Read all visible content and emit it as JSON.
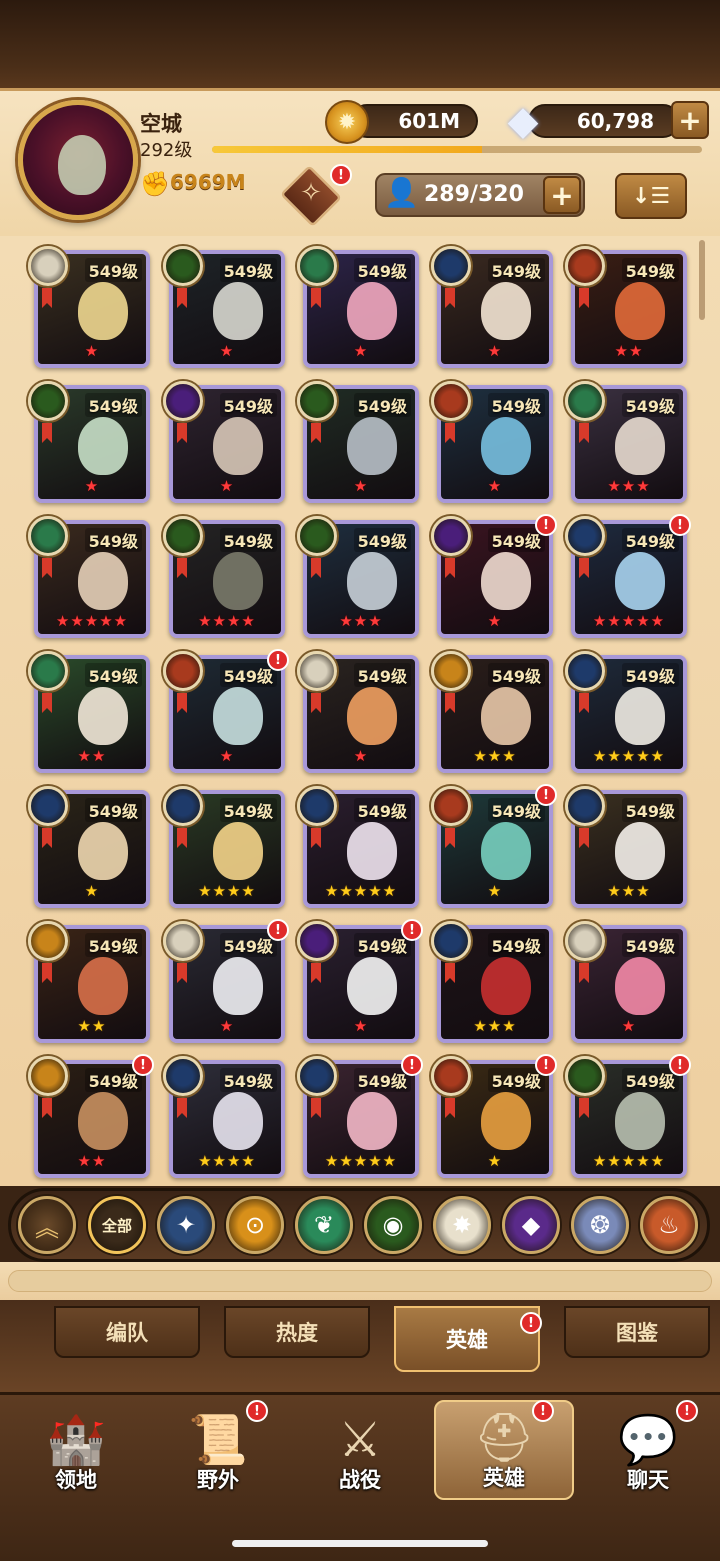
{
  "player": {
    "name": "空城",
    "level": "292级",
    "xp_fraction": 0.55,
    "power": "6969M"
  },
  "currency": {
    "gold": "601M",
    "diamonds": "60,798",
    "plus": "+"
  },
  "roster": {
    "count": "289/320",
    "plus": "+",
    "sort_label": "↓☰"
  },
  "badge_mark": "!",
  "heroes": [
    {
      "level": "549级",
      "stars": "★",
      "star_color": "red",
      "faction": "celestial",
      "badge": false,
      "art": "#3a3020",
      "face": "#f0d890"
    },
    {
      "level": "549级",
      "stars": "★",
      "star_color": "red",
      "faction": "wilder",
      "badge": false,
      "art": "#1e2428",
      "face": "#d8d8d0"
    },
    {
      "level": "549级",
      "stars": "★",
      "star_color": "red",
      "faction": "mauler",
      "badge": false,
      "art": "#2c2448",
      "face": "#f2a8c0"
    },
    {
      "level": "549级",
      "stars": "★",
      "star_color": "red",
      "faction": "lightbearer",
      "badge": false,
      "art": "#3a2a20",
      "face": "#f4e6d4"
    },
    {
      "level": "549级",
      "stars": "★★",
      "star_color": "red",
      "faction": "hypogean",
      "badge": false,
      "art": "#3a1e14",
      "face": "#e26a3a"
    },
    {
      "level": "549级",
      "stars": "★",
      "star_color": "red",
      "faction": "wilder",
      "badge": false,
      "art": "#2a3a2a",
      "face": "#c8e0c8"
    },
    {
      "level": "549级",
      "stars": "★",
      "star_color": "red",
      "faction": "graveborn",
      "badge": false,
      "art": "#2e2430",
      "face": "#d8c8b8"
    },
    {
      "level": "549级",
      "stars": "★",
      "star_color": "red",
      "faction": "wilder",
      "badge": false,
      "art": "#202c24",
      "face": "#b8c0c8"
    },
    {
      "level": "549级",
      "stars": "★",
      "star_color": "red",
      "faction": "hypogean",
      "badge": false,
      "art": "#1e3040",
      "face": "#78c0e0"
    },
    {
      "level": "549级",
      "stars": "★★★",
      "star_color": "red",
      "faction": "mauler",
      "badge": false,
      "art": "#3a3040",
      "face": "#e8dcd0"
    },
    {
      "level": "549级",
      "stars": "★★★★★",
      "star_color": "red",
      "faction": "mauler",
      "badge": false,
      "art": "#3a2a1e",
      "face": "#e6d0b8"
    },
    {
      "level": "549级",
      "stars": "★★★★",
      "star_color": "red",
      "faction": "wilder",
      "badge": false,
      "art": "#242424",
      "face": "#7a7a6a"
    },
    {
      "level": "549级",
      "stars": "★★★",
      "star_color": "red",
      "faction": "wilder",
      "badge": false,
      "art": "#1e2e3e",
      "face": "#c8d0d8"
    },
    {
      "level": "549级",
      "stars": "★",
      "star_color": "red",
      "faction": "graveborn",
      "badge": true,
      "art": "#3a1420",
      "face": "#f0dcd0"
    },
    {
      "level": "549级",
      "stars": "★★★★★",
      "star_color": "red",
      "faction": "lightbearer",
      "badge": true,
      "art": "#1e2a3e",
      "face": "#a8d4f0"
    },
    {
      "level": "549级",
      "stars": "★★",
      "star_color": "red",
      "faction": "mauler",
      "badge": false,
      "art": "#2a4a2a",
      "face": "#f2e8d8"
    },
    {
      "level": "549级",
      "stars": "★",
      "star_color": "red",
      "faction": "hypogean",
      "badge": true,
      "art": "#1e2a34",
      "face": "#c8e0e0"
    },
    {
      "level": "549级",
      "stars": "★",
      "star_color": "red",
      "faction": "celestial",
      "badge": false,
      "art": "#2a2420",
      "face": "#f0a060"
    },
    {
      "level": "549级",
      "stars": "★★★",
      "star_color": "gold",
      "faction": "dimensional",
      "badge": false,
      "art": "#2a1e1a",
      "face": "#e8c8a8"
    },
    {
      "level": "549级",
      "stars": "★★★★★",
      "star_color": "gold",
      "faction": "lightbearer",
      "badge": false,
      "art": "#1e2a3a",
      "face": "#f0ece4"
    },
    {
      "level": "549级",
      "stars": "★",
      "star_color": "gold",
      "faction": "lightbearer",
      "badge": false,
      "art": "#2a2418",
      "face": "#f0d8b0"
    },
    {
      "level": "549级",
      "stars": "★★★★",
      "star_color": "gold",
      "faction": "lightbearer",
      "badge": false,
      "art": "#2a3a24",
      "face": "#f4d48a"
    },
    {
      "level": "549级",
      "stars": "★★★★★",
      "star_color": "gold",
      "faction": "lightbearer",
      "badge": false,
      "art": "#2a1e2e",
      "face": "#f0e4f0"
    },
    {
      "level": "549级",
      "stars": "★",
      "star_color": "gold",
      "faction": "hypogean",
      "badge": true,
      "art": "#1e3a3a",
      "face": "#78d0c0"
    },
    {
      "level": "549级",
      "stars": "★★★",
      "star_color": "gold",
      "faction": "lightbearer",
      "badge": false,
      "art": "#3a3020",
      "face": "#f4f0ea"
    },
    {
      "level": "549级",
      "stars": "★★",
      "star_color": "gold",
      "faction": "dimensional",
      "badge": false,
      "art": "#3a2416",
      "face": "#d8704a"
    },
    {
      "level": "549级",
      "stars": "★",
      "star_color": "red",
      "faction": "celestial",
      "badge": true,
      "art": "#2a2a34",
      "face": "#f0f0f4"
    },
    {
      "level": "549级",
      "stars": "★",
      "star_color": "red",
      "faction": "graveborn",
      "badge": true,
      "art": "#2a2030",
      "face": "#f4f4f4"
    },
    {
      "level": "549级",
      "stars": "★★★",
      "star_color": "gold",
      "faction": "lightbearer",
      "badge": false,
      "art": "#1e1418",
      "face": "#c83030"
    },
    {
      "level": "549级",
      "stars": "★",
      "star_color": "red",
      "faction": "celestial",
      "badge": false,
      "art": "#3a2434",
      "face": "#f48aa8"
    },
    {
      "level": "549级",
      "stars": "★★",
      "star_color": "red",
      "faction": "dimensional",
      "badge": true,
      "art": "#2a1e14",
      "face": "#c89060"
    },
    {
      "level": "549级",
      "stars": "★★★★",
      "star_color": "gold",
      "faction": "lightbearer",
      "badge": false,
      "art": "#2e2e3a",
      "face": "#e8e4f0"
    },
    {
      "level": "549级",
      "stars": "★★★★★",
      "star_color": "gold",
      "faction": "lightbearer",
      "badge": true,
      "art": "#3a2430",
      "face": "#f4b8c8"
    },
    {
      "level": "549级",
      "stars": "★",
      "star_color": "gold",
      "faction": "hypogean",
      "badge": true,
      "art": "#3a2a14",
      "face": "#e8a040"
    },
    {
      "level": "549级",
      "stars": "★★★★★",
      "star_color": "gold",
      "faction": "wilder",
      "badge": true,
      "art": "#2a2e28",
      "face": "#b8c0b0"
    }
  ],
  "factions": [
    {
      "id": "all",
      "label": "全部",
      "bg": "#3a2a1a",
      "glyph": ""
    },
    {
      "id": "lightbearer",
      "label": "",
      "bg": "#2a4a7a",
      "glyph": "✦"
    },
    {
      "id": "dimensional",
      "label": "",
      "bg": "#d8901a",
      "glyph": "⊙"
    },
    {
      "id": "mauler",
      "label": "",
      "bg": "#2a8a5a",
      "glyph": "❦"
    },
    {
      "id": "wilder",
      "label": "",
      "bg": "#2a5a1e",
      "glyph": "◉"
    },
    {
      "id": "celestial",
      "label": "",
      "bg": "#e8e0cc",
      "glyph": "✸"
    },
    {
      "id": "graveborn",
      "label": "",
      "bg": "#5a2a8a",
      "glyph": "◆"
    },
    {
      "id": "hypogean",
      "label": "",
      "bg": "#7a8ab8",
      "glyph": "❂"
    },
    {
      "id": "hypogean2",
      "label": "",
      "bg": "#c85a2a",
      "glyph": "♨"
    }
  ],
  "collapse_glyph": "︽",
  "subtabs": [
    {
      "label": "编队",
      "active": false,
      "badge": false
    },
    {
      "label": "热度",
      "active": false,
      "badge": false
    },
    {
      "label": "英雄",
      "active": true,
      "badge": true
    },
    {
      "label": "图鉴",
      "active": false,
      "badge": false
    }
  ],
  "nav": [
    {
      "label": "领地",
      "icon": "castle-icon",
      "glyph": "🏰",
      "active": false,
      "badge": false
    },
    {
      "label": "野外",
      "icon": "map-scroll-icon",
      "glyph": "📜",
      "active": false,
      "badge": true
    },
    {
      "label": "战役",
      "icon": "sword-shield-icon",
      "glyph": "⚔",
      "active": false,
      "badge": false
    },
    {
      "label": "英雄",
      "icon": "helmet-icon",
      "glyph": "⛑",
      "active": true,
      "badge": true
    },
    {
      "label": "聊天",
      "icon": "chat-bubble-icon",
      "glyph": "💬",
      "active": false,
      "badge": true
    }
  ],
  "faction_colors": {
    "lightbearer": "#1e3a6a",
    "dimensional": "#c8841a",
    "mauler": "#2a7a4a",
    "wilder": "#2a5a1e",
    "celestial": "#d8d0bc",
    "graveborn": "#4a1e7a",
    "hypogean": "#a83a1e"
  }
}
